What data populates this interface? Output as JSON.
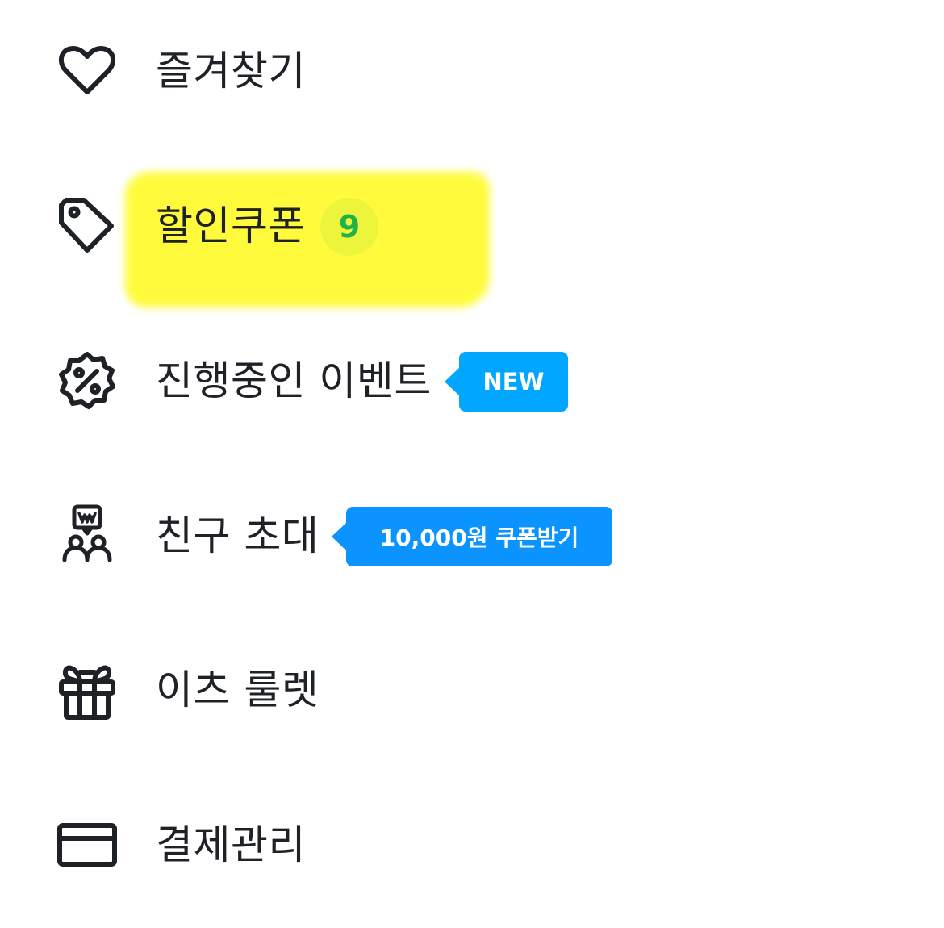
{
  "menu": {
    "items": [
      {
        "label": "즐겨찾기",
        "icon": "heart-icon"
      },
      {
        "label": "할인쿠폰",
        "icon": "tag-icon",
        "count": "9",
        "highlighted": true
      },
      {
        "label": "진행중인 이벤트",
        "icon": "discount-badge-icon",
        "tip": "NEW"
      },
      {
        "label": "친구 초대",
        "icon": "invite-friends-icon",
        "tip": "10,000원 쿠폰받기"
      },
      {
        "label": "이츠 룰렛",
        "icon": "gift-icon"
      },
      {
        "label": "결제관리",
        "icon": "credit-card-icon"
      }
    ]
  },
  "colors": {
    "text": "#1e2125",
    "highlight": "#fffb3c",
    "count_badge_bg": "#ecf53c",
    "count_badge_text": "#20b24a",
    "new_tip": "#00a6ff",
    "friend_tip": "#0b93ff"
  }
}
